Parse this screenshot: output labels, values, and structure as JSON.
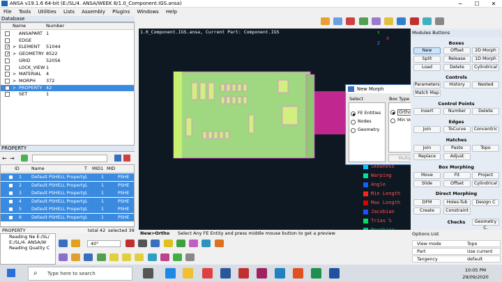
{
  "window": {
    "title": "ANSA v19.1.6 64-bit (E:/SL/4. ANSA/WEEK 8/1.0_Component.IGS.ansa)",
    "minimize": "─",
    "maximize": "☐",
    "close": "✕"
  },
  "menu": [
    "File",
    "Tools",
    "Utilities",
    "Lists",
    "Assembly",
    "Plugins",
    "Windows",
    "Help"
  ],
  "database": {
    "header": "Database",
    "columns": [
      "Name",
      "Number"
    ],
    "rows": [
      {
        "name": "ANSAPART",
        "number": "1",
        "checked": false,
        "expand": ""
      },
      {
        "name": "EDGE",
        "number": "",
        "checked": false,
        "expand": ""
      },
      {
        "name": "ELEMENT",
        "number": "51044",
        "checked": true,
        "expand": ">"
      },
      {
        "name": "GEOMETRY",
        "number": "8522",
        "checked": true,
        "expand": ">"
      },
      {
        "name": "GRID",
        "number": "52056",
        "checked": false,
        "expand": ""
      },
      {
        "name": "LOCK_VIEW",
        "number": "1",
        "checked": false,
        "expand": ""
      },
      {
        "name": "MATERIAL",
        "number": "4",
        "checked": false,
        "expand": ">"
      },
      {
        "name": "MORPH",
        "number": "372",
        "checked": false,
        "expand": ">"
      },
      {
        "name": "PROPERTY",
        "number": "42",
        "checked": false,
        "expand": ">",
        "selected": true
      },
      {
        "name": "SET",
        "number": "1",
        "checked": false,
        "expand": ""
      }
    ]
  },
  "property": {
    "header": "PROPERTY",
    "columns": [
      "ID",
      "Name",
      "T",
      "MID1",
      "MID",
      "PSHE"
    ],
    "rows": [
      {
        "id": "1",
        "name": "Default PSHELL Property",
        "t": "1.",
        "mid": "1",
        "type": "PSHE"
      },
      {
        "id": "2",
        "name": "Default PSHELL Property",
        "t": "1.",
        "mid": "1",
        "type": "PSHE"
      },
      {
        "id": "3",
        "name": "Default PSHELL Property",
        "t": "1.",
        "mid": "1",
        "type": "PSHE"
      },
      {
        "id": "4",
        "name": "Default PSHELL Property",
        "t": "1.",
        "mid": "1",
        "type": "PSHE"
      },
      {
        "id": "5",
        "name": "Default PSHELL Property",
        "t": "1.",
        "mid": "1",
        "type": "PSHE"
      },
      {
        "id": "6",
        "name": "Default PSHELL Property",
        "t": "1.",
        "mid": "1",
        "type": "PSHE"
      }
    ],
    "status_name": "PROPERTY",
    "status_total": "total 42",
    "status_selected": "selected 39"
  },
  "info": {
    "lines": [
      "Reading Ne E:/SL/",
      "E:/SL/4. ANSA/W",
      "Reading Quality C"
    ],
    "tab": "Info"
  },
  "viewport": {
    "title": "1.0_Component.IGS.ansa,  Current Part: Component.IGS",
    "quality": [
      "Skewness",
      "Warping",
      "Angle",
      "Min Length",
      "Max Length",
      "Jacobian",
      "Trias %",
      "Morphing Action"
    ],
    "quality_colors": [
      "#00c8ff",
      "#00e0a0",
      "#1060ff",
      "#ff2020",
      "#e00000",
      "#2050ff",
      "#00e060",
      "#00c080"
    ],
    "axis_y": "Y",
    "axis_x": "X",
    "axis_z": "Z"
  },
  "status": {
    "mode": "New>Ortho",
    "message": "Select Any FE Entity and press middle mouse button to get a preview",
    "zoom": "40°"
  },
  "morph_dialog": {
    "title": "New Morph",
    "select_label": "Select",
    "select_options": [
      "FE Entities",
      "Nodes",
      "Geometry"
    ],
    "select_checked": 0,
    "box_label": "Box Type",
    "box_options": [
      "Ortho",
      "Min Volume"
    ],
    "box_checked": 0,
    "multiple": "Multiple"
  },
  "modules": {
    "header": "Modules Buttons",
    "boxes": {
      "title": "Boxes",
      "buttons": [
        "New",
        "Offset",
        "2D Morph",
        "Split",
        "Release",
        "1D Morph",
        "Load",
        "Delete",
        "Cylindrical"
      ]
    },
    "controls": {
      "title": "Controls",
      "buttons": [
        "Parameters",
        "History",
        "Nested",
        "Match Map"
      ]
    },
    "control_points": {
      "title": "Control Points",
      "buttons": [
        "Insert",
        "Number",
        "Delete"
      ]
    },
    "edges": {
      "title": "Edges",
      "buttons": [
        "Join",
        "ToCurve",
        "Concentric"
      ]
    },
    "hatches": {
      "title": "Hatches",
      "buttons": [
        "Join",
        "Paste",
        "Topo",
        "Replace",
        "Adjust"
      ]
    },
    "box_morphing": {
      "title": "Box Morphing",
      "buttons": [
        "Move",
        "Fit",
        "Project",
        "Slide",
        "Offset",
        "Cylindrical"
      ]
    },
    "direct_morphing": {
      "title": "Direct Morphing",
      "buttons": [
        "DFM",
        "Holes-Tub",
        "Design C",
        "Create",
        "Constraint"
      ]
    },
    "checks": {
      "title": "Checks",
      "buttons": [
        "Geometry C."
      ]
    }
  },
  "options": {
    "header": "Options List",
    "rows": [
      {
        "k": "View mode",
        "v": "Topo"
      },
      {
        "k": "Part",
        "v": "Use current"
      },
      {
        "k": "Tangency",
        "v": "default"
      }
    ]
  },
  "taskbar": {
    "search": "Type here to search",
    "time": "10:05 PM",
    "date": "29/09/2020"
  }
}
